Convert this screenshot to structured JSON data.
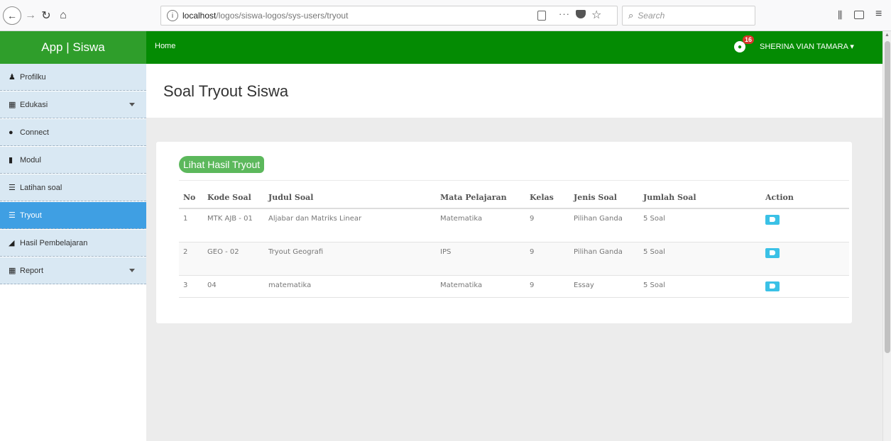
{
  "browser": {
    "url_prefix": "localhost",
    "url_path": "/logos/siswa-logos/sys-users/tryout",
    "search_placeholder": "Search"
  },
  "header": {
    "brand": "App | Siswa",
    "home": "Home",
    "notification_count": "16",
    "user_name": "SHERINA VIAN TAMARA ▾"
  },
  "sidebar": {
    "items": [
      {
        "label": "Profilku",
        "icon": "user-icon"
      },
      {
        "label": "Edukasi",
        "icon": "grid-icon"
      },
      {
        "label": "Connect",
        "icon": "globe-icon"
      },
      {
        "label": "Modul",
        "icon": "book-icon"
      },
      {
        "label": "Latihan soal",
        "icon": "list-icon"
      },
      {
        "label": "Tryout",
        "icon": "list-icon"
      },
      {
        "label": "Hasil Pembelajaran",
        "icon": "folder-icon"
      },
      {
        "label": "Report",
        "icon": "table-icon"
      }
    ]
  },
  "main": {
    "title": "Soal Tryout Siswa",
    "button_hasil": "Lihat Hasil Tryout",
    "table": {
      "headers": [
        "No",
        "Kode Soal",
        "Judul Soal",
        "Mata Pelajaran",
        "Kelas",
        "Jenis Soal",
        "Jumlah Soal",
        "Action"
      ],
      "rows": [
        [
          "1",
          "MTK AJB - 01",
          "Aljabar dan Matriks Linear",
          "Matematika",
          "9",
          "Pilihan Ganda",
          "5 Soal"
        ],
        [
          "2",
          "GEO - 02",
          "Tryout Geografi",
          "IPS",
          "9",
          "Pilihan Ganda",
          "5 Soal"
        ],
        [
          "3",
          "04",
          "matematika",
          "Matematika",
          "9",
          "Essay",
          "5 Soal"
        ]
      ]
    }
  },
  "colors": {
    "header_green": "#048b03",
    "active_blue": "#3f9fe3",
    "button_green": "#5cb85c"
  }
}
